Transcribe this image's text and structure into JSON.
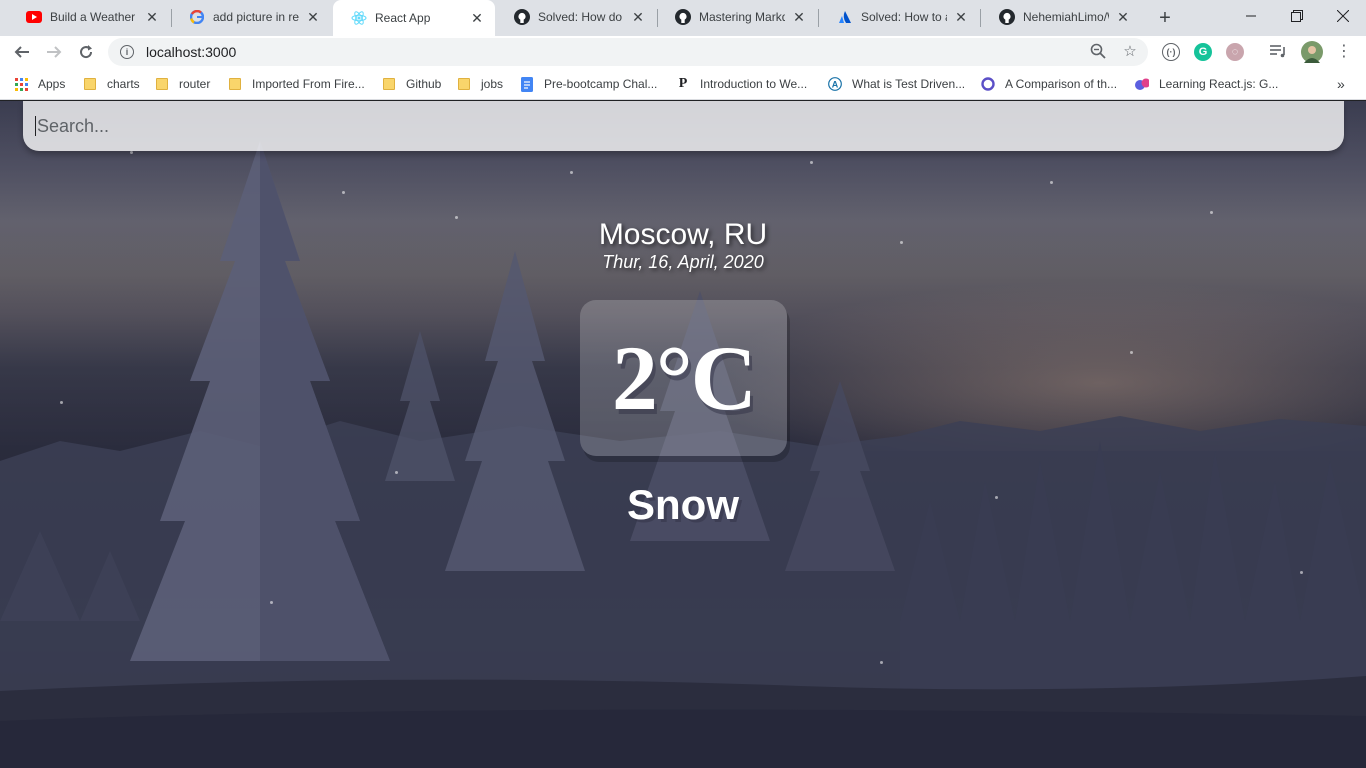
{
  "browser": {
    "tabs": [
      {
        "title": "Build a Weather A",
        "icon": "youtube-icon"
      },
      {
        "title": "add picture in reac",
        "icon": "google-icon"
      },
      {
        "title": "React App",
        "icon": "react-icon"
      },
      {
        "title": "Solved: How do yo",
        "icon": "github-icon"
      },
      {
        "title": "Mastering Markdo",
        "icon": "github-icon"
      },
      {
        "title": "Solved: How to ad",
        "icon": "atlassian-icon"
      },
      {
        "title": "NehemiahLimo/W",
        "icon": "github-icon"
      }
    ],
    "active_tab_index": 2,
    "url": "localhost:3000",
    "bookmarks": [
      {
        "label": "Apps",
        "icon": "apps-grid-icon"
      },
      {
        "label": "charts",
        "icon": "folder-icon"
      },
      {
        "label": "router",
        "icon": "folder-icon"
      },
      {
        "label": "Imported From Fire...",
        "icon": "folder-icon"
      },
      {
        "label": "Github",
        "icon": "folder-icon"
      },
      {
        "label": "jobs",
        "icon": "folder-icon"
      },
      {
        "label": "Pre-bootcamp Chal...",
        "icon": "docs-icon"
      },
      {
        "label": "Introduction to We...",
        "icon": "p-icon"
      },
      {
        "label": "What is Test Driven...",
        "icon": "a-icon"
      },
      {
        "label": "A Comparison of th...",
        "icon": "circle-icon"
      },
      {
        "label": "Learning React.js: G...",
        "icon": "learning-icon"
      }
    ],
    "overflow_label": "»"
  },
  "app": {
    "search_placeholder": "Search...",
    "location": "Moscow, RU",
    "date": "Thur, 16, April, 2020",
    "temperature": "2°C",
    "weather": "Snow"
  },
  "colors": {
    "tabstrip_bg": "#dee1e6",
    "toolbar_bg": "#ffffff",
    "text_white": "#ffffff"
  }
}
